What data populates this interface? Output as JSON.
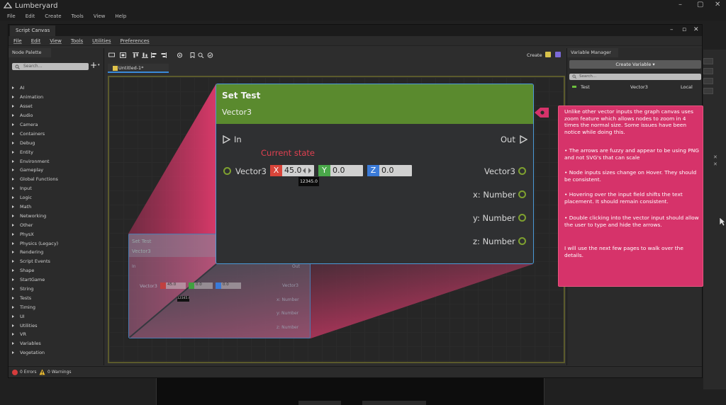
{
  "app": {
    "title": "Lumberyard",
    "menu": [
      "File",
      "Edit",
      "Create",
      "Tools",
      "View",
      "Help"
    ]
  },
  "script_canvas": {
    "tab_title": "Script Canvas",
    "menu": [
      "File",
      "Edit",
      "View",
      "Tools",
      "Utilities",
      "Preferences"
    ],
    "create_label": "Create",
    "doc_tab": "Untitled-1*",
    "status": {
      "errors": "0 Errors",
      "warnings": "0 Warnings"
    }
  },
  "node_palette": {
    "title": "Node Palette",
    "search_placeholder": "Search...",
    "items": [
      "AI",
      "Animation",
      "Asset",
      "Audio",
      "Camera",
      "Containers",
      "Debug",
      "Entity",
      "Environment",
      "Gameplay",
      "Global Functions",
      "Input",
      "Logic",
      "Math",
      "Networking",
      "Other",
      "PhysX",
      "Physics (Legacy)",
      "Rendering",
      "Script Events",
      "Shape",
      "StartGame",
      "String",
      "Tests",
      "Timing",
      "UI",
      "Utilities",
      "VR",
      "Variables",
      "Vegetation"
    ]
  },
  "variable_manager": {
    "title": "Variable Manager",
    "create_button": "Create Variable ▾",
    "search_placeholder": "Search...",
    "variables": [
      {
        "name": "Test",
        "type": "Vector3",
        "scope": "Local"
      }
    ]
  },
  "small_node": {
    "title": "Set Test",
    "subtitle": "Vector3",
    "in": "In",
    "out": "Out",
    "input_label": "Vector3",
    "x": "45.0",
    "y": "0.0",
    "z": "0.0",
    "tooltip": "12345.0",
    "out_vector": "Vector3",
    "x_number": "x: Number",
    "y_number": "y: Number",
    "z_number": "z: Number"
  },
  "big_node": {
    "title": "Set Test",
    "subtitle": "Vector3",
    "in": "In",
    "out": "Out",
    "current_state": "Current state",
    "input_label": "Vector3",
    "x_label": "X",
    "x_value": "45.0",
    "y_label": "Y",
    "y_value": "0.0",
    "z_label": "Z",
    "z_value": "0.0",
    "tooltip": "12345.0",
    "out_vector": "Vector3",
    "x_number": "x: Number",
    "y_number": "y: Number",
    "z_number": "z: Number"
  },
  "comment": {
    "p1": "Unlike other vector inputs the graph canvas uses zoom feature which allows nodes to zoom in 4 times the normal size. Some issues have been notice while doing this.",
    "p2": "• The arrows are fuzzy and appear to be using PNG and not SVG's that can scale",
    "p3": "• Node inputs sizes change on Hover. They should be consistent.",
    "p4": "• Hovering over the input field shifts the text placement. It should remain consistent.",
    "p5": "• Double clicking into the vector input should allow the user to type and hide the arrows.",
    "p6": "I will use the next few pages to walk over the details."
  },
  "colors": {
    "node_header": "#5a8a2e",
    "comment_bg": "#d6336a",
    "x_axis": "#d9453a",
    "y_axis": "#4aa84a",
    "z_axis": "#3a7ad8",
    "selection": "#4b9ad8"
  }
}
